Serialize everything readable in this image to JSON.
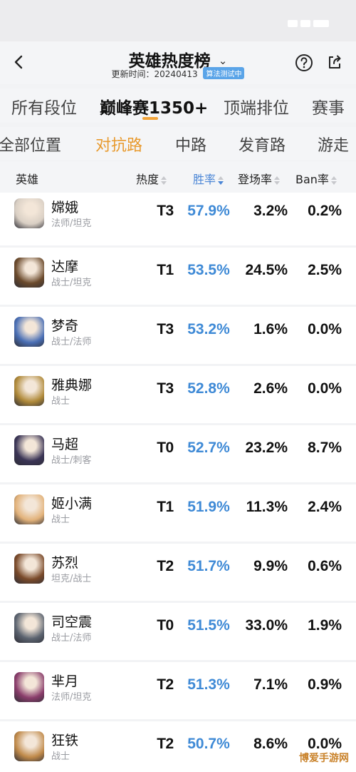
{
  "header": {
    "title": "英雄热度榜",
    "update_label": "更新时间：20240413",
    "badge": "算法测试中"
  },
  "tier_tabs": [
    "所有段位",
    "巅峰赛1350+",
    "顶端排位",
    "赛事"
  ],
  "position_tabs": [
    "全部位置",
    "对抗路",
    "中路",
    "发育路",
    "游走"
  ],
  "columns": {
    "hero": "英雄",
    "heat": "热度",
    "win_rate": "胜率",
    "pick_rate": "登场率",
    "ban_rate": "Ban率"
  },
  "heroes": [
    {
      "name": "嫦娥",
      "role": "法师/坦克",
      "tier": "T3",
      "win_rate": "57.9%",
      "pick_rate": "3.2%",
      "ban_rate": "0.2%"
    },
    {
      "name": "达摩",
      "role": "战士/坦克",
      "tier": "T1",
      "win_rate": "53.5%",
      "pick_rate": "24.5%",
      "ban_rate": "2.5%"
    },
    {
      "name": "梦奇",
      "role": "战士/法师",
      "tier": "T3",
      "win_rate": "53.2%",
      "pick_rate": "1.6%",
      "ban_rate": "0.0%"
    },
    {
      "name": "雅典娜",
      "role": "战士",
      "tier": "T3",
      "win_rate": "52.8%",
      "pick_rate": "2.6%",
      "ban_rate": "0.0%"
    },
    {
      "name": "马超",
      "role": "战士/刺客",
      "tier": "T0",
      "win_rate": "52.7%",
      "pick_rate": "23.2%",
      "ban_rate": "8.7%"
    },
    {
      "name": "姬小满",
      "role": "战士",
      "tier": "T1",
      "win_rate": "51.9%",
      "pick_rate": "11.3%",
      "ban_rate": "2.4%"
    },
    {
      "name": "苏烈",
      "role": "坦克/战士",
      "tier": "T2",
      "win_rate": "51.7%",
      "pick_rate": "9.9%",
      "ban_rate": "0.6%"
    },
    {
      "name": "司空震",
      "role": "战士/法师",
      "tier": "T0",
      "win_rate": "51.5%",
      "pick_rate": "33.0%",
      "ban_rate": "1.9%"
    },
    {
      "name": "芈月",
      "role": "法师/坦克",
      "tier": "T2",
      "win_rate": "51.3%",
      "pick_rate": "7.1%",
      "ban_rate": "0.9%"
    },
    {
      "name": "狂铁",
      "role": "战士",
      "tier": "T2",
      "win_rate": "50.7%",
      "pick_rate": "8.6%",
      "ban_rate": "0.0%"
    }
  ],
  "avatar_colors": [
    "#d9cfc4",
    "#6b4a2c",
    "#4a6fb5",
    "#b08a3a",
    "#3b3556",
    "#e2b27a",
    "#7a4a2a",
    "#5c6470",
    "#8a3d6b",
    "#c08a4a"
  ],
  "watermark": {
    "text": "博爱手游网"
  },
  "colors": {
    "accent_orange": "#e89a2e",
    "accent_blue": "#3f8ad6"
  }
}
